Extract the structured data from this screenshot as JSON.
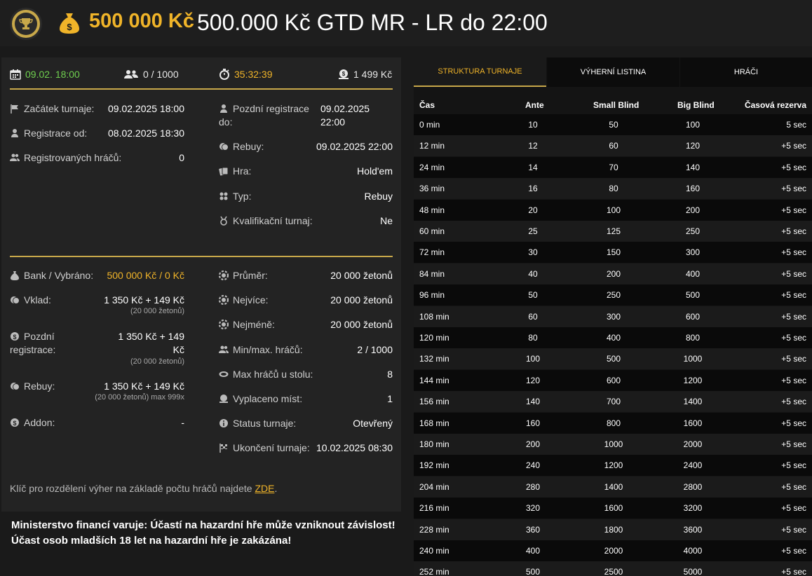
{
  "header": {
    "amount": "500 000 Kč",
    "title": "500.000 Kč GTD MR - LR do 22:00"
  },
  "stats": {
    "date": "09.02. 18:00",
    "players": "0 / 1000",
    "timer": "35:32:39",
    "buyin": "1 499 Kč"
  },
  "info": {
    "start_label": "Začátek turnaje:",
    "start_value": "09.02.2025 18:00",
    "reg_from_label": "Registrace od:",
    "reg_from_value": "08.02.2025 18:30",
    "registered_label": "Registrovaných hráčů:",
    "registered_value": "0",
    "late_reg_label_1": "Pozdní registrace",
    "late_reg_label_2": "do:",
    "late_reg_value_1": "09.02.2025",
    "late_reg_value_2": "22:00",
    "rebuy_label": "Rebuy:",
    "rebuy_value": "09.02.2025 22:00",
    "game_label": "Hra:",
    "game_value": "Hold'em",
    "type_label": "Typ:",
    "type_value": "Rebuy",
    "qualif_label": "Kvalifikační turnaj:",
    "qualif_value": "Ne"
  },
  "money": {
    "bank_label": "Bank / Vybráno:",
    "bank_value": "500 000 Kč / 0 Kč",
    "deposit_label": "Vklad:",
    "deposit_value": "1 350 Kč + 149 Kč",
    "deposit_sub": "(20 000 žetonů)",
    "late_label_1": "Pozdní",
    "late_label_2": "registrace:",
    "late_value_1": "1 350 Kč + 149",
    "late_value_2": "Kč",
    "late_sub": "(20 000 žetonů)",
    "rebuy_label": "Rebuy:",
    "rebuy_value": "1 350 Kč + 149 Kč",
    "rebuy_sub": "(20 000 žetonů) max 999x",
    "addon_label": "Addon:",
    "addon_value": "-",
    "avg_label": "Průměr:",
    "avg_value": "20 000 žetonů",
    "most_label": "Nejvíce:",
    "most_value": "20 000 žetonů",
    "least_label": "Nejméně:",
    "least_value": "20 000 žetonů",
    "minmax_label": "Min/max. hráčů:",
    "minmax_value": "2 / 1000",
    "table_label": "Max hráčů u stolu:",
    "table_value": "8",
    "paid_label": "Vyplaceno míst:",
    "paid_value": "1",
    "status_label": "Status turnaje:",
    "status_value": "Otevřený",
    "end_label": "Ukončení turnaje:",
    "end_value": "10.02.2025 08:30"
  },
  "footer": {
    "note": "Klíč pro rozdělení výher na základě počtu hráčů najdete",
    "link": "ZDE",
    "dot": ".",
    "warning_1": "Ministerstvo financí varuje: Účastí na hazardní hře může vzniknout závislost!",
    "warning_2": "Účast osob mladších 18 let na hazardní hře je zakázána!"
  },
  "tabs": [
    "STRUKTURA TURNAJE",
    "VÝHERNÍ LISTINA",
    "HRÁČI"
  ],
  "columns": [
    "Čas",
    "Ante",
    "Small Blind",
    "Big Blind",
    "Časová rezerva"
  ],
  "rows": [
    [
      "0 min",
      "10",
      "50",
      "100",
      "5 sec"
    ],
    [
      "12 min",
      "12",
      "60",
      "120",
      "+5 sec"
    ],
    [
      "24 min",
      "14",
      "70",
      "140",
      "+5 sec"
    ],
    [
      "36 min",
      "16",
      "80",
      "160",
      "+5 sec"
    ],
    [
      "48 min",
      "20",
      "100",
      "200",
      "+5 sec"
    ],
    [
      "60 min",
      "25",
      "125",
      "250",
      "+5 sec"
    ],
    [
      "72 min",
      "30",
      "150",
      "300",
      "+5 sec"
    ],
    [
      "84 min",
      "40",
      "200",
      "400",
      "+5 sec"
    ],
    [
      "96 min",
      "50",
      "250",
      "500",
      "+5 sec"
    ],
    [
      "108 min",
      "60",
      "300",
      "600",
      "+5 sec"
    ],
    [
      "120 min",
      "80",
      "400",
      "800",
      "+5 sec"
    ],
    [
      "132 min",
      "100",
      "500",
      "1000",
      "+5 sec"
    ],
    [
      "144 min",
      "120",
      "600",
      "1200",
      "+5 sec"
    ],
    [
      "156 min",
      "140",
      "700",
      "1400",
      "+5 sec"
    ],
    [
      "168 min",
      "160",
      "800",
      "1600",
      "+5 sec"
    ],
    [
      "180 min",
      "200",
      "1000",
      "2000",
      "+5 sec"
    ],
    [
      "192 min",
      "240",
      "1200",
      "2400",
      "+5 sec"
    ],
    [
      "204 min",
      "280",
      "1400",
      "2800",
      "+5 sec"
    ],
    [
      "216 min",
      "320",
      "1600",
      "3200",
      "+5 sec"
    ],
    [
      "228 min",
      "360",
      "1800",
      "3600",
      "+5 sec"
    ],
    [
      "240 min",
      "400",
      "2000",
      "4000",
      "+5 sec"
    ],
    [
      "252 min",
      "500",
      "2500",
      "5000",
      "+5 sec"
    ]
  ],
  "colors": {
    "accent": "#f0b429",
    "gold_line": "#c8a84a",
    "date_green": "#6fcf4f"
  }
}
